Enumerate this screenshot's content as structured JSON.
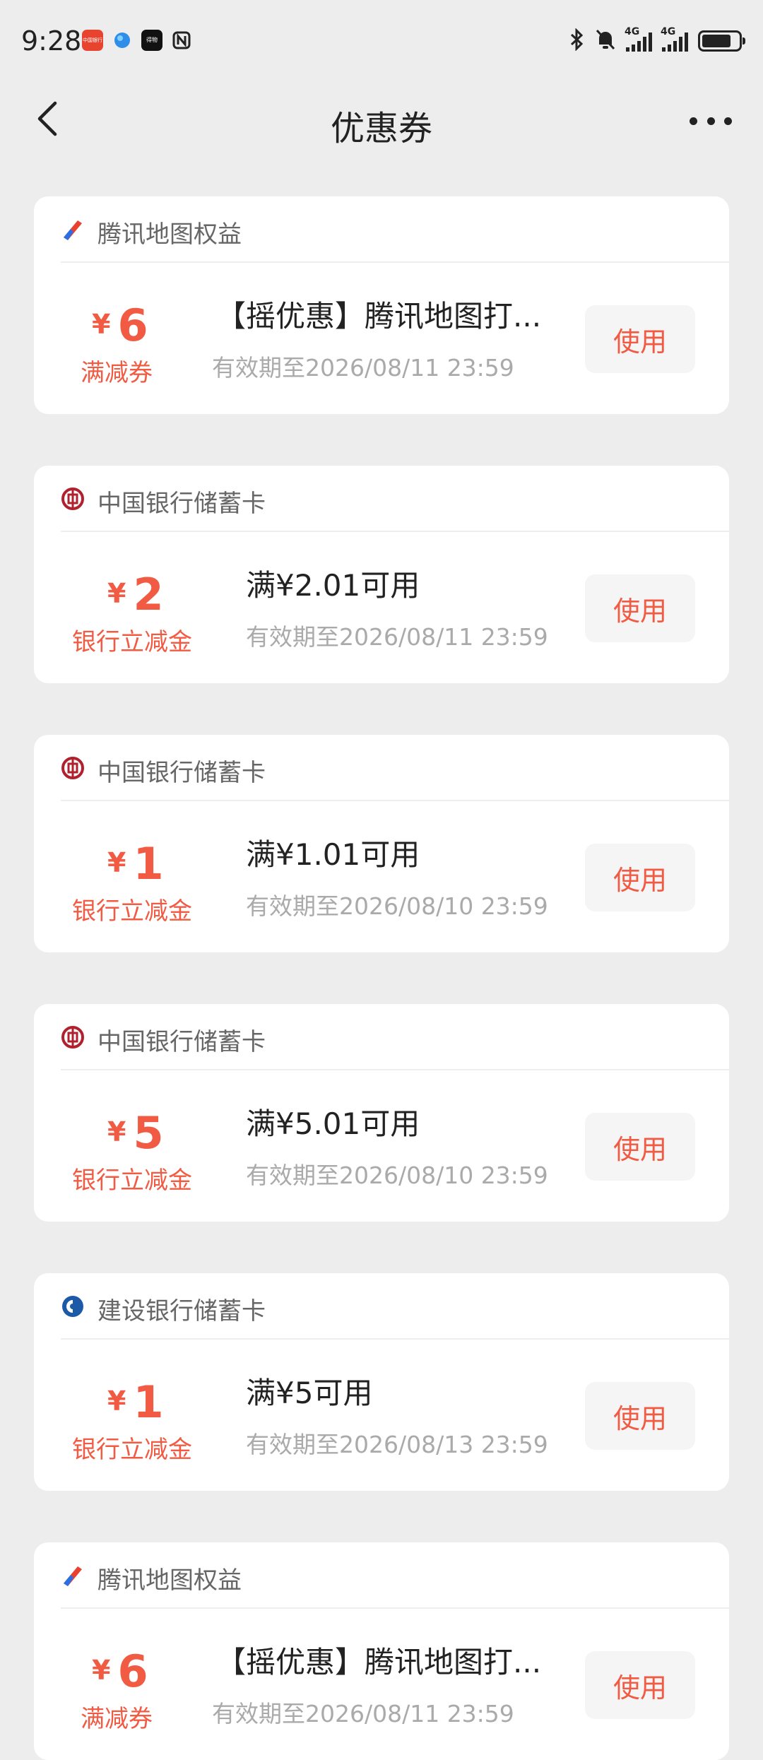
{
  "status_bar": {
    "time": "9:28",
    "signal_1_label": "4G",
    "signal_2_label": "4G",
    "icons": [
      "bluetooth-icon",
      "mute-bell-icon",
      "signal-icon",
      "signal-icon",
      "battery-icon"
    ],
    "app_icons": [
      "bank-app-icon",
      "browser-icon",
      "app-icon",
      "nfc-icon"
    ],
    "app_chip_1": "中国银行",
    "app_chip_3": "得物"
  },
  "header": {
    "title": "优惠券",
    "back_icon": "back-arrow-icon",
    "more_icon": "more-dots-icon"
  },
  "colors": {
    "accent": "#f25b43",
    "background": "#ededed",
    "card": "#ffffff"
  },
  "coupons": [
    {
      "merchant": "腾讯地图权益",
      "merchant_icon": "tencent-map-icon",
      "currency": "¥",
      "amount": "6",
      "type": "满减券",
      "title": "【摇优惠】腾讯地图打...",
      "expiry": "有效期至2026/08/11 23:59",
      "button": "使用"
    },
    {
      "merchant": "中国银行储蓄卡",
      "merchant_icon": "bank-of-china-icon",
      "currency": "¥",
      "amount": "2",
      "type": "银行立减金",
      "title": "满¥2.01可用",
      "expiry": "有效期至2026/08/11 23:59",
      "button": "使用"
    },
    {
      "merchant": "中国银行储蓄卡",
      "merchant_icon": "bank-of-china-icon",
      "currency": "¥",
      "amount": "1",
      "type": "银行立减金",
      "title": "满¥1.01可用",
      "expiry": "有效期至2026/08/10 23:59",
      "button": "使用"
    },
    {
      "merchant": "中国银行储蓄卡",
      "merchant_icon": "bank-of-china-icon",
      "currency": "¥",
      "amount": "5",
      "type": "银行立减金",
      "title": "满¥5.01可用",
      "expiry": "有效期至2026/08/10 23:59",
      "button": "使用"
    },
    {
      "merchant": "建设银行储蓄卡",
      "merchant_icon": "ccb-icon",
      "currency": "¥",
      "amount": "1",
      "type": "银行立减金",
      "title": "满¥5可用",
      "expiry": "有效期至2026/08/13 23:59",
      "button": "使用"
    },
    {
      "merchant": "腾讯地图权益",
      "merchant_icon": "tencent-map-icon",
      "currency": "¥",
      "amount": "6",
      "type": "满减券",
      "title": "【摇优惠】腾讯地图打...",
      "expiry": "有效期至2026/08/11 23:59",
      "button": "使用"
    }
  ]
}
